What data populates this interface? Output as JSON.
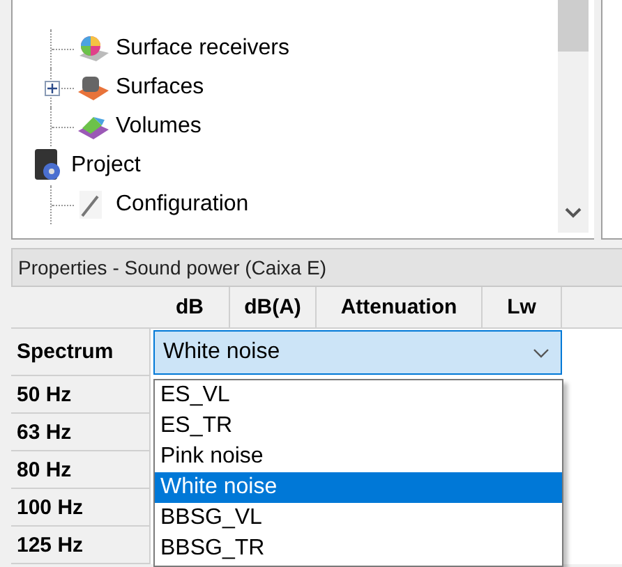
{
  "tree": {
    "items": [
      {
        "children": [
          {
            "label": "Surface receivers",
            "kind": "receivers"
          },
          {
            "label": "Surfaces",
            "kind": "surfaces",
            "expanded": false
          },
          {
            "label": "Volumes",
            "kind": "volumes"
          }
        ]
      },
      {
        "label": "Project",
        "kind": "project",
        "children": [
          {
            "label": "Configuration",
            "kind": "config"
          }
        ]
      }
    ]
  },
  "properties": {
    "title": "Properties - Sound power (Caixa E)",
    "columns": [
      "dB",
      "dB(A)",
      "Attenuation",
      "Lw"
    ],
    "spectrum": {
      "label": "Spectrum",
      "value": "White noise",
      "open": true
    },
    "rows": [
      "50 Hz",
      "63 Hz",
      "80 Hz",
      "100 Hz",
      "125 Hz"
    ],
    "options": [
      {
        "label": "ES_VL",
        "selected": false
      },
      {
        "label": "ES_TR",
        "selected": false
      },
      {
        "label": "Pink noise",
        "selected": false
      },
      {
        "label": "White noise",
        "selected": true
      },
      {
        "label": "BBSG_VL",
        "selected": false
      },
      {
        "label": "BBSG_TR",
        "selected": false
      }
    ]
  }
}
